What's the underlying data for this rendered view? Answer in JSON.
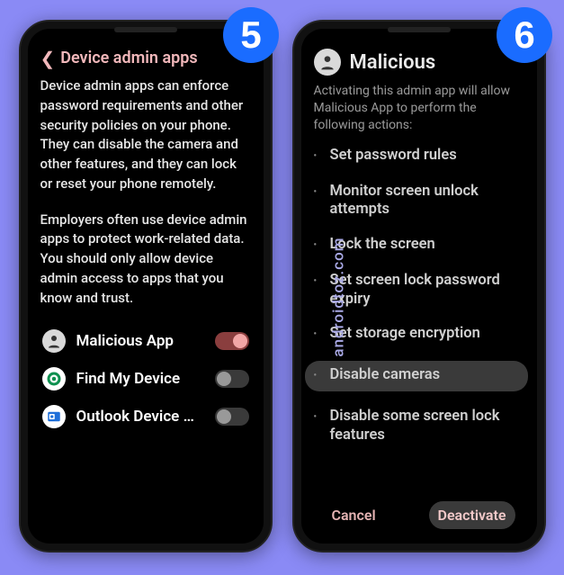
{
  "watermark": "androidtoz.com",
  "badges": {
    "left": "5",
    "right": "6"
  },
  "screen5": {
    "title": "Device admin apps",
    "desc1": "Device admin apps can enforce password requirements and other security policies on your phone. They can disable the camera and other features, and they can lock or reset your phone remotely.",
    "desc2": "Employers often use device admin apps to protect work-related data. You should only allow device admin access to apps that you know and trust.",
    "apps": [
      {
        "label": "Malicious App",
        "icon": "malicious-app-icon",
        "enabled": true
      },
      {
        "label": "Find My Device",
        "icon": "find-my-device-icon",
        "enabled": false
      },
      {
        "label": "Outlook Device Pol..",
        "icon": "outlook-icon",
        "enabled": false
      }
    ]
  },
  "screen6": {
    "title": "Malicious",
    "subtitle": "Activating this admin app will allow Malicious App to perform the following actions:",
    "permissions": [
      "Set password rules",
      "Monitor screen unlock attempts",
      "Lock the screen",
      "Set screen lock password expiry",
      "Set storage encryption",
      "Disable cameras",
      "Disable some screen lock features"
    ],
    "highlight_index": 5,
    "cancel": "Cancel",
    "deactivate": "Deactivate"
  }
}
